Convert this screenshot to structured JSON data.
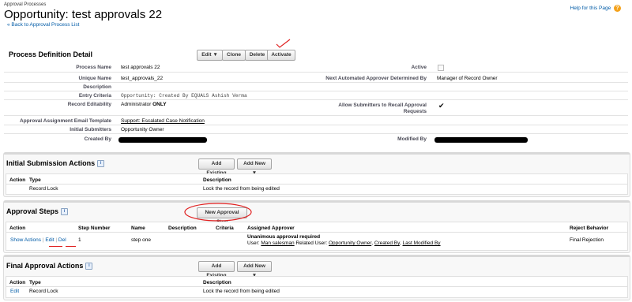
{
  "header": {
    "breadcrumb": "Approval Processes",
    "title": "Opportunity: test approvals 22",
    "back_link": "« Back to Approval Process List",
    "help_link": "Help for this Page",
    "help_icon": "question-icon"
  },
  "detail": {
    "section_title": "Process Definition Detail",
    "buttons": {
      "edit": "Edit ▼",
      "clone": "Clone",
      "delete": "Delete",
      "activate": "Activate"
    },
    "fields": {
      "process_name_label": "Process Name",
      "process_name": "test approvals 22",
      "unique_name_label": "Unique Name",
      "unique_name": "test_approvals_22",
      "description_label": "Description",
      "entry_criteria_label": "Entry Criteria",
      "entry_criteria": "Opportunity: Created By EQUALS Ashish Verma",
      "record_editability_label": "Record Editability",
      "record_editability_prefix": "Administrator",
      "record_editability_strong": "ONLY",
      "email_template_label": "Approval Assignment Email Template",
      "email_template": "Support: Escalated Case Notification",
      "initial_submitters_label": "Initial Submitters",
      "initial_submitters": "Opportunity Owner",
      "created_by_label": "Created By",
      "active_label": "Active",
      "next_approver_label": "Next Automated Approver Determined By",
      "next_approver": "Manager of Record Owner",
      "allow_recall_label_1": "Allow Submitters to Recall Approval",
      "allow_recall_label_2": "Requests",
      "allow_recall_check": "✔",
      "modified_by_label": "Modified By"
    }
  },
  "initial_submission": {
    "title": "Initial Submission Actions",
    "add_existing": "Add Existing",
    "add_new": "Add New ▼",
    "columns": [
      "Action",
      "Type",
      "Description"
    ],
    "rows": [
      {
        "action": "",
        "type": "Record Lock",
        "description": "Lock the record from being edited"
      }
    ]
  },
  "approval_steps": {
    "title": "Approval Steps",
    "new_step_button": "New Approval Step",
    "columns": [
      "Action",
      "Step Number",
      "Name",
      "Description",
      "Criteria",
      "Assigned Approver",
      "Reject Behavior"
    ],
    "row": {
      "show_actions": "Show Actions",
      "sep1": "|",
      "edit": "Edit",
      "sep2": "|",
      "del": "Del",
      "step_number": "1",
      "name": "step one",
      "description": "",
      "criteria": "",
      "approver_title": "Unanimous approval required",
      "user_label": "User:",
      "user": "Man salesman",
      "related_label": "Related User:",
      "related_1": "Opportunity Owner",
      "comma_1": ",",
      "related_2": "Created By",
      "comma_2": ",",
      "related_3": "Last Modified By",
      "reject_behavior": "Final Rejection"
    }
  },
  "final_approval": {
    "title": "Final Approval Actions",
    "add_existing": "Add Existing",
    "add_new": "Add New ▼",
    "columns": [
      "Action",
      "Type",
      "Description"
    ],
    "rows": [
      {
        "action": "Edit",
        "type": "Record Lock",
        "description": "Lock the record from being edited"
      }
    ]
  },
  "colors": {
    "link": "#015ba7",
    "annotation": "#e02020",
    "help_icon": "#f4a21c"
  }
}
